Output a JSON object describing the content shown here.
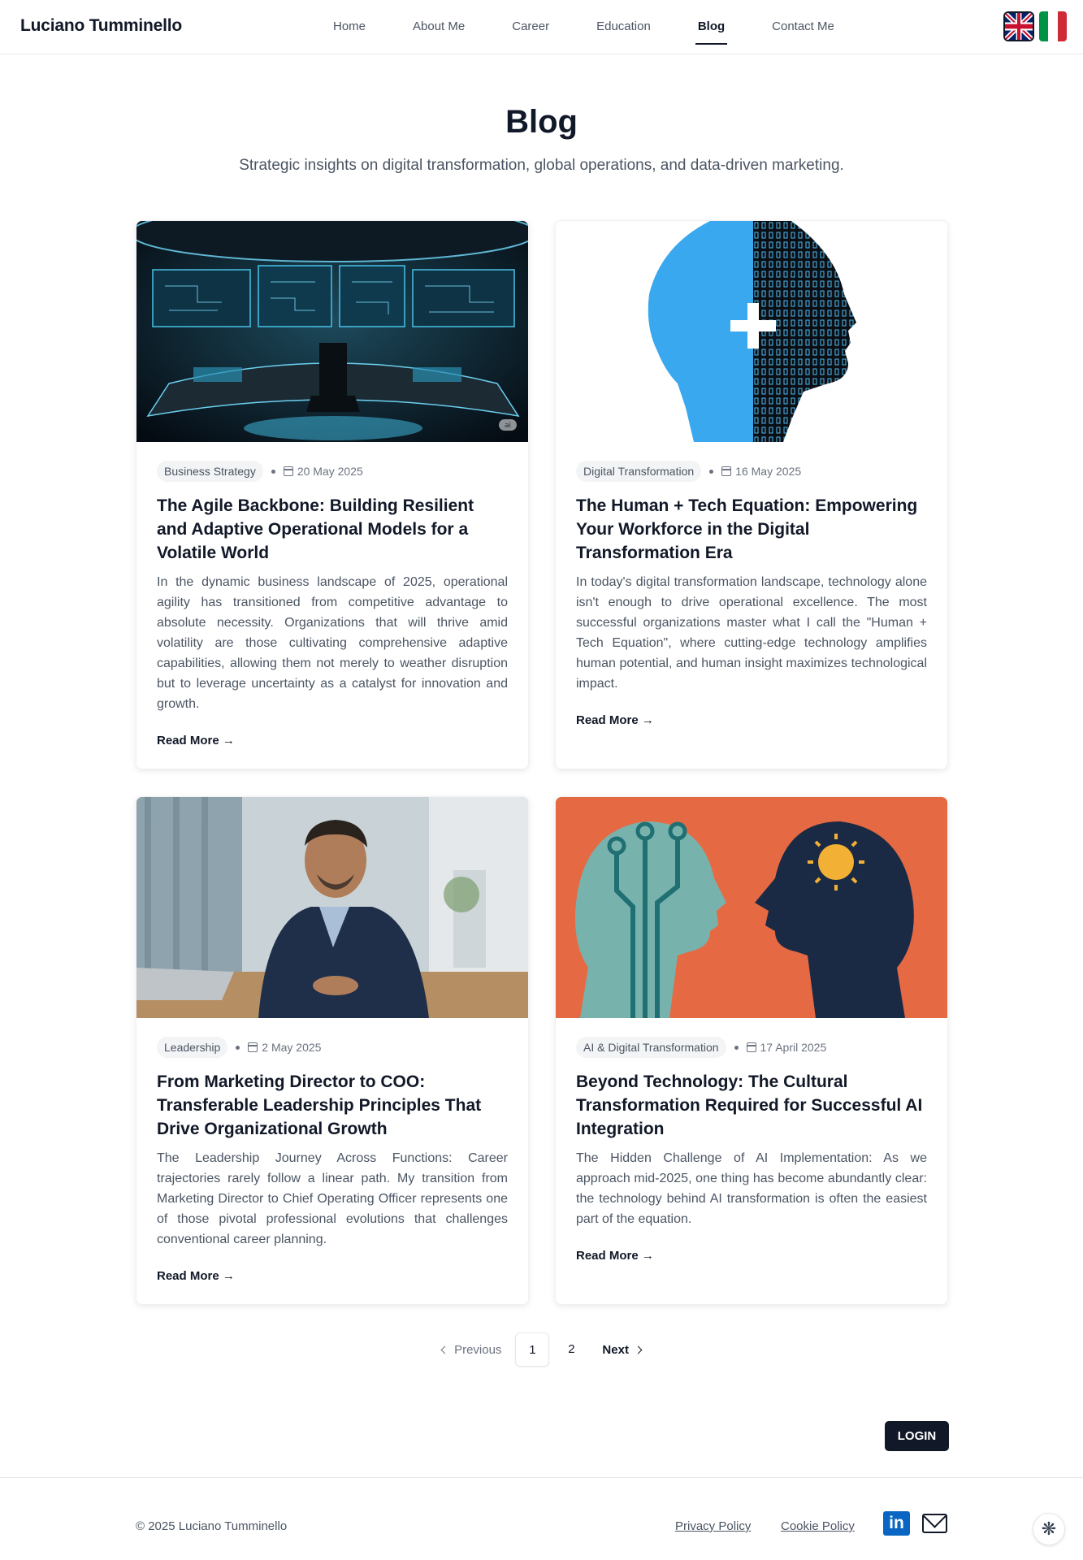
{
  "brand": "Luciano Tumminello",
  "nav": {
    "items": [
      {
        "label": "Home"
      },
      {
        "label": "About Me"
      },
      {
        "label": "Career"
      },
      {
        "label": "Education"
      },
      {
        "label": "Blog",
        "active": true
      },
      {
        "label": "Contact Me"
      }
    ]
  },
  "languages": [
    "uk-flag-icon",
    "italy-flag-icon"
  ],
  "hero": {
    "title": "Blog",
    "subtitle": "Strategic insights on digital transformation, global operations, and data-driven marketing."
  },
  "posts": [
    {
      "category": "Business Strategy",
      "date": "20 May 2025",
      "title": "The Agile Backbone: Building Resilient and Adaptive Operational Models for a Volatile World",
      "excerpt": "In the dynamic business landscape of 2025, operational agility has transitioned from competitive advantage to absolute necessity. Organizations that will thrive amid volatility are those cultivating comprehensive adaptive capabilities, allowing them not merely to weather disruption but to leverage uncertainty as a catalyst for innovation and growth.",
      "read_more": "Read More →",
      "image_badge": "ai"
    },
    {
      "category": "Digital Transformation",
      "date": "16 May 2025",
      "title": "The Human + Tech Equation: Empowering Your Workforce in the Digital Transformation Era",
      "excerpt": "In today's digital transformation landscape, technology alone isn't enough to drive operational excellence. The most successful organizations master what I call the \"Human + Tech Equation\", where cutting-edge technology amplifies human potential, and human insight maximizes technological impact.",
      "read_more": "Read More →"
    },
    {
      "category": "Leadership",
      "date": "2 May 2025",
      "title": "From Marketing Director to COO: Transferable Leadership Principles That Drive Organizational Growth",
      "excerpt": "The Leadership Journey Across Functions: Career trajectories rarely follow a linear path. My transition from Marketing Director to Chief Operating Officer represents one of those pivotal professional evolutions that challenges conventional career planning.",
      "read_more": "Read More →"
    },
    {
      "category": "AI & Digital Transformation",
      "date": "17 April 2025",
      "title": "Beyond Technology: The Cultural Transformation Required for Successful AI Integration",
      "excerpt": "The Hidden Challenge of AI Implementation: As we approach mid-2025, one thing has become abundantly clear: the technology behind AI transformation is often the easiest part of the equation.",
      "read_more": "Read More →"
    }
  ],
  "pagination": {
    "previous": "Previous",
    "pages": [
      "1",
      "2"
    ],
    "current": "1",
    "next": "Next"
  },
  "login": "LOGIN",
  "footer": {
    "copyright": "© 2025 Luciano Tumminello",
    "links": [
      "Privacy Policy",
      "Cookie Policy"
    ],
    "linkedin_text": "in",
    "social_icons": [
      "linkedin-icon",
      "mail-icon"
    ]
  },
  "colors": {
    "primary": "#111827",
    "muted": "#4b5563",
    "tag_bg": "#f3f4f6",
    "linkedin": "#0a66c2"
  }
}
